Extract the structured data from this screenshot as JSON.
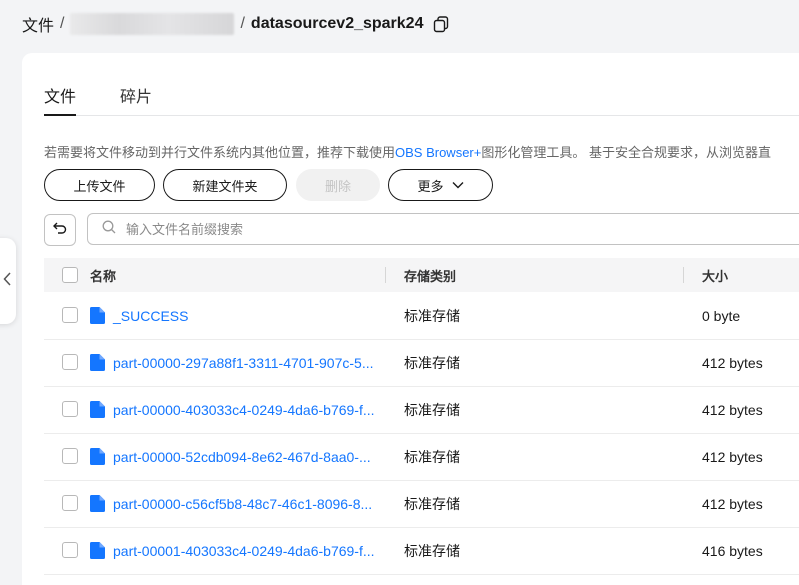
{
  "breadcrumb": {
    "root": "文件",
    "separator": "/",
    "current": "datasourcev2_spark24"
  },
  "tabs": [
    {
      "label": "文件",
      "active": true
    },
    {
      "label": "碎片",
      "active": false
    }
  ],
  "notice": {
    "before": "若需要将文件移动到并行文件系统内其他位置，推荐下载使用",
    "link": "OBS Browser+",
    "after": "图形化管理工具。 基于安全合规要求，从浏览器直"
  },
  "toolbar": {
    "upload_label": "上传文件",
    "new_folder_label": "新建文件夹",
    "delete_label": "删除",
    "more_label": "更多"
  },
  "search": {
    "placeholder": "输入文件名前缀搜索"
  },
  "table": {
    "columns": [
      "名称",
      "存储类别",
      "大小"
    ],
    "rows": [
      {
        "name": "_SUCCESS",
        "storage": "标准存储",
        "size": "0 byte"
      },
      {
        "name": "part-00000-297a88f1-3311-4701-907c-5...",
        "storage": "标准存储",
        "size": "412 bytes"
      },
      {
        "name": "part-00000-403033c4-0249-4da6-b769-f...",
        "storage": "标准存储",
        "size": "412 bytes"
      },
      {
        "name": "part-00000-52cdb094-8e62-467d-8aa0-...",
        "storage": "标准存储",
        "size": "412 bytes"
      },
      {
        "name": "part-00000-c56cf5b8-48c7-46c1-8096-8...",
        "storage": "标准存储",
        "size": "412 bytes"
      },
      {
        "name": "part-00001-403033c4-0249-4da6-b769-f...",
        "storage": "标准存储",
        "size": "416 bytes"
      }
    ]
  },
  "icons": {
    "copy": "copy-icon",
    "collapse": "chevron-left-icon",
    "refresh": "back-arrow-icon",
    "search": "search-icon",
    "file": "file-icon",
    "more": "chevron-down-icon"
  },
  "colors": {
    "link": "#1476ff",
    "text": "#191919",
    "background": "#f3f4f6"
  }
}
